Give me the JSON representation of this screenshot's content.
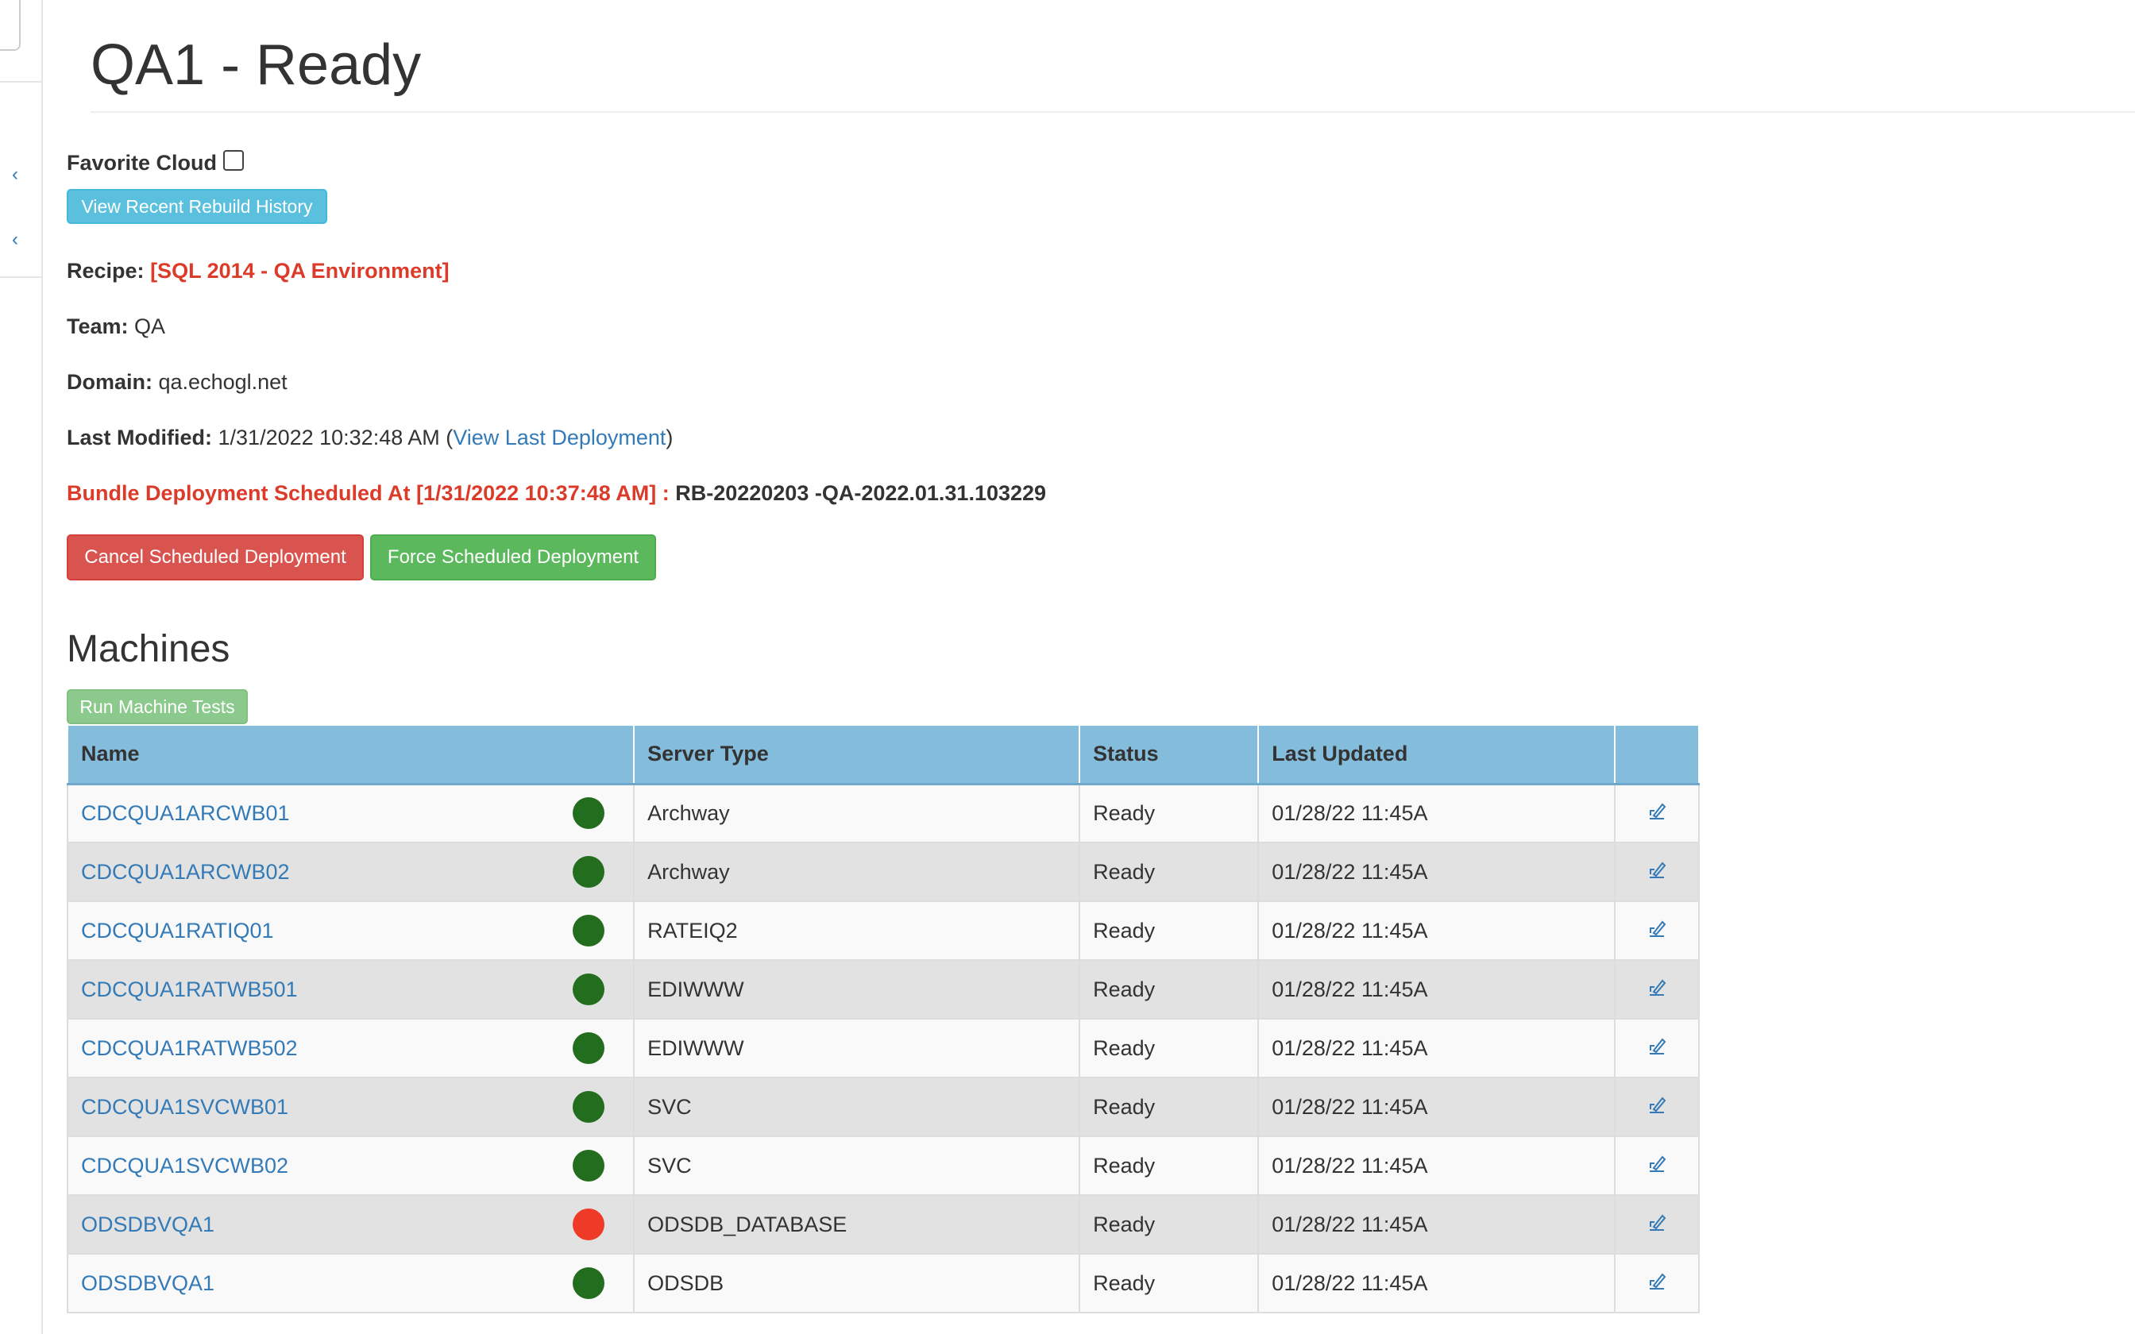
{
  "page": {
    "title": "QA1 - Ready"
  },
  "favorite": {
    "label": "Favorite Cloud"
  },
  "buttons": {
    "rebuild_history": "View Recent Rebuild History",
    "cancel_deployment": "Cancel Scheduled Deployment",
    "force_deployment": "Force Scheduled Deployment",
    "run_tests": "Run Machine Tests"
  },
  "details": {
    "recipe_label": "Recipe:",
    "recipe_value": "[SQL 2014 - QA Environment]",
    "team_label": "Team:",
    "team_value": "QA",
    "domain_label": "Domain:",
    "domain_value": "qa.echogl.net",
    "modified_label": "Last Modified:",
    "modified_value": "1/31/2022 10:32:48 AM",
    "modified_open": " (",
    "modified_link": "View Last Deployment",
    "modified_close": ")",
    "bundle_label": "Bundle Deployment Scheduled At [1/31/2022 10:37:48 AM] :",
    "bundle_value": "RB-20220203 -QA-2022.01.31.103229"
  },
  "machines": {
    "section_title": "Machines",
    "columns": [
      "Name",
      "Server Type",
      "Status",
      "Last Updated",
      ""
    ],
    "rows": [
      {
        "name": "CDCQUA1ARCWB01",
        "server_type": "Archway",
        "status": "Ready",
        "last_updated": "01/28/22 11:45A",
        "health": "green"
      },
      {
        "name": "CDCQUA1ARCWB02",
        "server_type": "Archway",
        "status": "Ready",
        "last_updated": "01/28/22 11:45A",
        "health": "green"
      },
      {
        "name": "CDCQUA1RATIQ01",
        "server_type": "RATEIQ2",
        "status": "Ready",
        "last_updated": "01/28/22 11:45A",
        "health": "green"
      },
      {
        "name": "CDCQUA1RATWB501",
        "server_type": "EDIWWW",
        "status": "Ready",
        "last_updated": "01/28/22 11:45A",
        "health": "green"
      },
      {
        "name": "CDCQUA1RATWB502",
        "server_type": "EDIWWW",
        "status": "Ready",
        "last_updated": "01/28/22 11:45A",
        "health": "green"
      },
      {
        "name": "CDCQUA1SVCWB01",
        "server_type": "SVC",
        "status": "Ready",
        "last_updated": "01/28/22 11:45A",
        "health": "green"
      },
      {
        "name": "CDCQUA1SVCWB02",
        "server_type": "SVC",
        "status": "Ready",
        "last_updated": "01/28/22 11:45A",
        "health": "green"
      },
      {
        "name": "ODSDBVQA1",
        "server_type": "ODSDB_DATABASE",
        "status": "Ready",
        "last_updated": "01/28/22 11:45A",
        "health": "red"
      },
      {
        "name": "ODSDBVQA1",
        "server_type": "ODSDB",
        "status": "Ready",
        "last_updated": "01/28/22 11:45A",
        "health": "green"
      }
    ]
  },
  "icons": {
    "sidebar_collapse_1": "chevron-left-icon",
    "sidebar_collapse_2": "chevron-left-icon",
    "row_edit": "edit-icon"
  },
  "colors": {
    "link": "#337ab7",
    "header": "#84bcdc",
    "healthy": "#236d1f",
    "unhealthy": "#ee3a26",
    "alert": "#dd3b2a"
  }
}
